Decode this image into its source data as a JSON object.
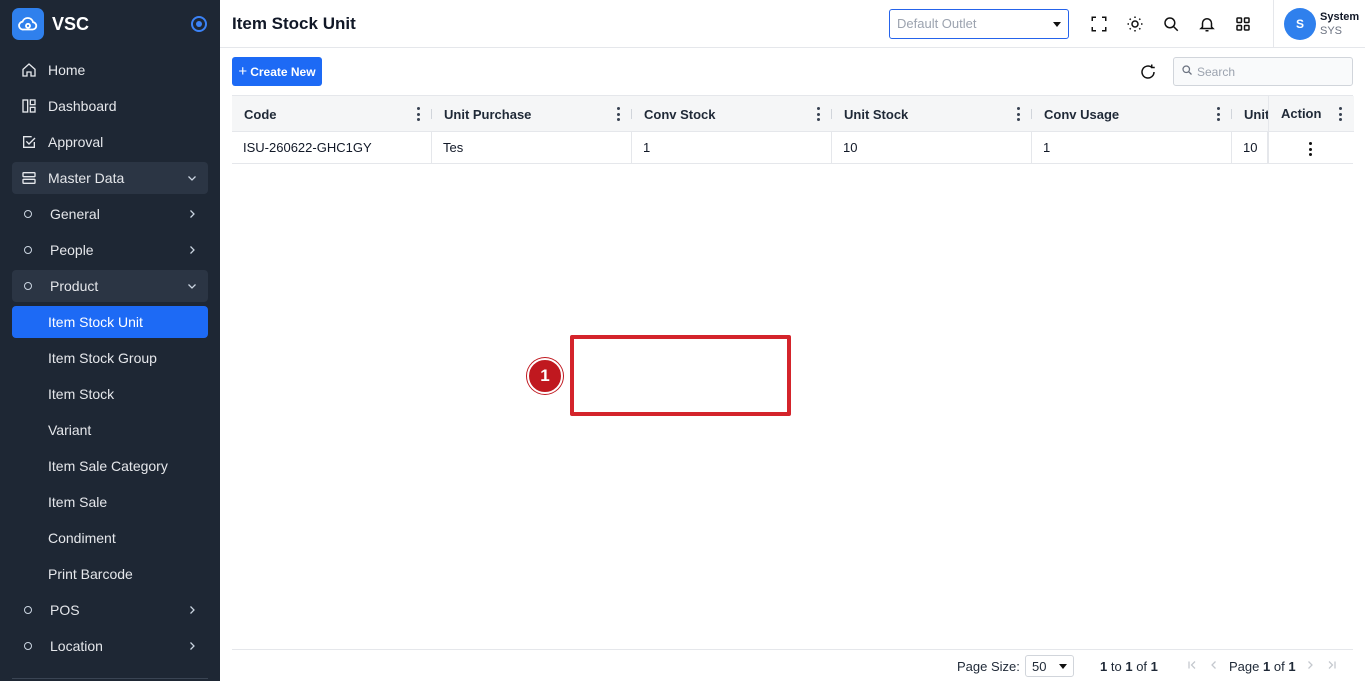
{
  "brand": {
    "name": "VSC"
  },
  "sidebar": {
    "items": [
      {
        "label": "Home"
      },
      {
        "label": "Dashboard"
      },
      {
        "label": "Approval"
      },
      {
        "label": "Master Data"
      },
      {
        "label": "General"
      },
      {
        "label": "People"
      },
      {
        "label": "Product"
      },
      {
        "label": "Item Stock Unit"
      },
      {
        "label": "Item Stock Group"
      },
      {
        "label": "Item Stock"
      },
      {
        "label": "Variant"
      },
      {
        "label": "Item Sale Category"
      },
      {
        "label": "Item Sale"
      },
      {
        "label": "Condiment"
      },
      {
        "label": "Print Barcode"
      },
      {
        "label": "POS"
      },
      {
        "label": "Location"
      }
    ]
  },
  "header": {
    "title": "Item Stock Unit",
    "outlet_placeholder": "Default Outlet",
    "user_name": "System",
    "user_role": "SYS",
    "avatar_letter": "S"
  },
  "toolbar": {
    "create_label": "Create New",
    "search_placeholder": "Search"
  },
  "table": {
    "columns": [
      "Code",
      "Unit Purchase",
      "Conv Stock",
      "Unit Stock",
      "Conv Usage",
      "Unit",
      "Action"
    ],
    "rows": [
      [
        "ISU-260622-GHC1GY",
        "Tes",
        "1",
        "10",
        "1",
        "10"
      ]
    ]
  },
  "annotation": {
    "badge": "1"
  },
  "pagination": {
    "page_size_label": "Page Size:",
    "page_size": "50",
    "range_from": "1",
    "range_to_word": "to",
    "range_to": "1",
    "range_of_word": "of",
    "range_total": "1",
    "page_word": "Page",
    "page_current": "1",
    "page_of_word": "of",
    "page_total": "1"
  },
  "colors": {
    "sidebar_bg": "#1e2734",
    "accent": "#1d6af5",
    "annotation": "#d4242b"
  }
}
